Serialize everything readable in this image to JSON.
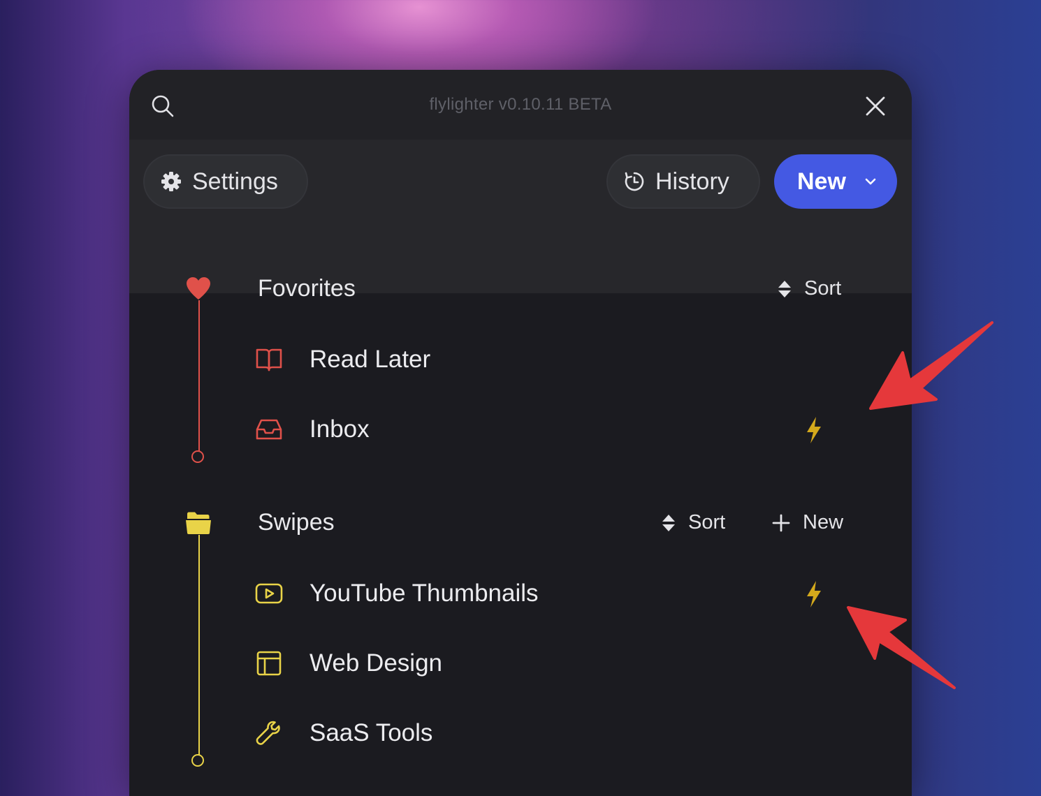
{
  "window": {
    "title": "flylighter v0.10.11 BETA"
  },
  "toolbar": {
    "settings_label": "Settings",
    "history_label": "History",
    "new_label": "New"
  },
  "sections": [
    {
      "title": "Fovorites",
      "accent": "#e0514a",
      "icon": "heart-icon",
      "sort_label": "Sort",
      "items": [
        {
          "label": "Read Later",
          "icon": "book-open-icon",
          "quick": false
        },
        {
          "label": "Inbox",
          "icon": "inbox-icon",
          "quick": true
        }
      ]
    },
    {
      "title": "Swipes",
      "accent": "#e9d348",
      "icon": "folder-icon",
      "sort_label": "Sort",
      "new_label": "New",
      "items": [
        {
          "label": "YouTube Thumbnails",
          "icon": "youtube-icon",
          "quick": true
        },
        {
          "label": "Web Design",
          "icon": "layout-icon",
          "quick": false
        },
        {
          "label": "SaaS Tools",
          "icon": "wrench-icon",
          "quick": false
        }
      ]
    }
  ],
  "colors": {
    "primary": "#4459e3",
    "bolt": "#d4a91c",
    "annotation_arrow": "#e5383b"
  },
  "icons": {
    "quick_action": "lightning-bolt-icon",
    "annotation": "red-arrow-annotation"
  }
}
